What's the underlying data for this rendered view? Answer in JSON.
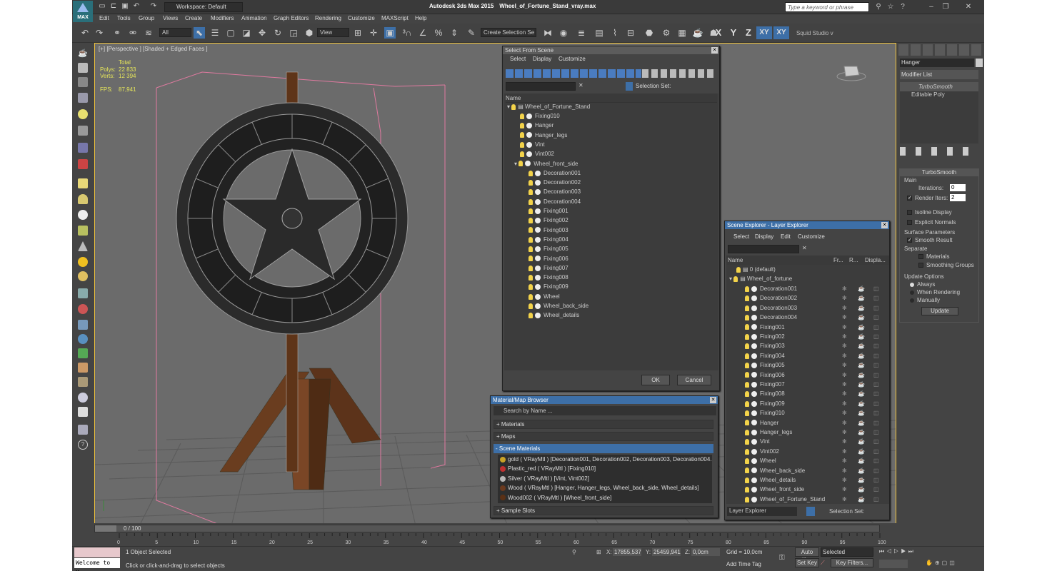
{
  "app": {
    "logo": "MAX",
    "title": "Autodesk 3ds Max  2015",
    "file": "Wheel_of_Fortune_Stand_vray.max",
    "workspace": "Workspace: Default",
    "search_placeholder": "Type a keyword or phrase"
  },
  "menus": [
    "Edit",
    "Tools",
    "Group",
    "Views",
    "Create",
    "Modifiers",
    "Animation",
    "Graph Editors",
    "Rendering",
    "Customize",
    "MAXScript",
    "Help"
  ],
  "toolbar": {
    "filter": "All",
    "refcoord": "View",
    "selset": "Create Selection Se",
    "axes": [
      "X",
      "Y",
      "Z",
      "XY",
      "XY"
    ],
    "studio": "Squid Studio v"
  },
  "viewport": {
    "label": "[+] [Perspective ] [Shaded + Edged Faces ]",
    "stats": {
      "total": "Total",
      "polys_label": "Polys:",
      "polys": "22 833",
      "verts_label": "Verts:",
      "verts": "12 394",
      "fps_label": "FPS:",
      "fps": "87,941"
    }
  },
  "select_from_scene": {
    "title": "Select From Scene",
    "menus": [
      "Select",
      "Display",
      "Customize"
    ],
    "selection_set": "Selection Set:",
    "col_name": "Name",
    "root": "Wheel_of_Fortune_Stand",
    "items": [
      "Fixing010",
      "Hanger",
      "Hanger_legs",
      "Vint",
      "Vint002",
      "Wheel_front_side"
    ],
    "children": [
      "Decoration001",
      "Decoration002",
      "Decoration003",
      "Decoration004",
      "Fixing001",
      "Fixing002",
      "Fixing003",
      "Fixing004",
      "Fixing005",
      "Fixing006",
      "Fixing007",
      "Fixing008",
      "Fixing009",
      "Wheel",
      "Wheel_back_side",
      "Wheel_details"
    ],
    "ok": "OK",
    "cancel": "Cancel"
  },
  "layer_explorer": {
    "title": "Scene Explorer - Layer Explorer",
    "menus": [
      "Select",
      "Display",
      "Edit",
      "Customize"
    ],
    "cols": [
      "Name",
      "Fr...",
      "R...",
      "Displa..."
    ],
    "layers": [
      "0 (default)",
      "Wheel_of_fortune"
    ],
    "items": [
      "Decoration001",
      "Decoration002",
      "Decoration003",
      "Decoration004",
      "Fixing001",
      "Fixing002",
      "Fixing003",
      "Fixing004",
      "Fixing005",
      "Fixing006",
      "Fixing007",
      "Fixing008",
      "Fixing009",
      "Fixing010",
      "Hanger",
      "Hanger_legs",
      "Vint",
      "Vint002",
      "Wheel",
      "Wheel_back_side",
      "Wheel_details",
      "Wheel_front_side",
      "Wheel_of_Fortune_Stand"
    ],
    "footer": "Layer Explorer",
    "selset": "Selection Set:"
  },
  "material_browser": {
    "title": "Material/Map Browser",
    "search": "Search by Name ...",
    "sections": [
      "+ Materials",
      "+ Maps",
      "- Scene Materials"
    ],
    "materials": [
      "gold  ( VRayMtl ) [Decoration001, Decoration002, Decoration003, Decoration004...",
      "Plastic_red  ( VRayMtl ) [Fixing010]",
      "Silver  ( VRayMtl ) [Vint, Vint002]",
      "Wood  ( VRayMtl ) [Hanger, Hanger_legs, Wheel_back_side, Wheel_details]",
      "Wood002  ( VRayMtl ) [Wheel_front_side]"
    ],
    "sample": "+ Sample Slots",
    "colors": [
      "#c9a227",
      "#c03030",
      "#b8b8b8",
      "#6b3a1f",
      "#5a3015"
    ]
  },
  "command_panel": {
    "name": "Hanger",
    "modlist": "Modifier List",
    "stack": [
      "TurboSmooth",
      "Editable Poly"
    ],
    "rollout": "TurboSmooth",
    "main": "Main",
    "iterations_label": "Iterations:",
    "iterations": "0",
    "render_iters_label": "Render Iters:",
    "render_iters": "2",
    "isoline": "Isoline Display",
    "explicit": "Explicit Normals",
    "surface": "Surface Parameters",
    "smooth": "Smooth Result",
    "separate": "Separate",
    "materials": "Materials",
    "smoothing": "Smoothing Groups",
    "update_opts": "Update Options",
    "always": "Always",
    "when_render": "When Rendering",
    "manually": "Manually",
    "update": "Update"
  },
  "timeline": {
    "frame": "0 / 100",
    "ticks": [
      "0",
      "5",
      "10",
      "15",
      "20",
      "25",
      "30",
      "35",
      "40",
      "45",
      "50",
      "55",
      "60",
      "65",
      "70",
      "75",
      "80",
      "85",
      "90",
      "95",
      "100"
    ]
  },
  "status": {
    "script": "Welcome to M:",
    "selected": "1 Object Selected",
    "prompt": "Click or click-and-drag to select objects",
    "x_label": "X:",
    "x": "17855,537",
    "y_label": "Y:",
    "y": "25459,941",
    "z_label": "Z:",
    "z": "0,0cm",
    "grid": "Grid = 10,0cm",
    "add_time_tag": "Add Time Tag",
    "auto_key": "Auto Key",
    "set_key": "Set Key",
    "selected_dd": "Selected",
    "key_filters": "Key Filters..."
  }
}
